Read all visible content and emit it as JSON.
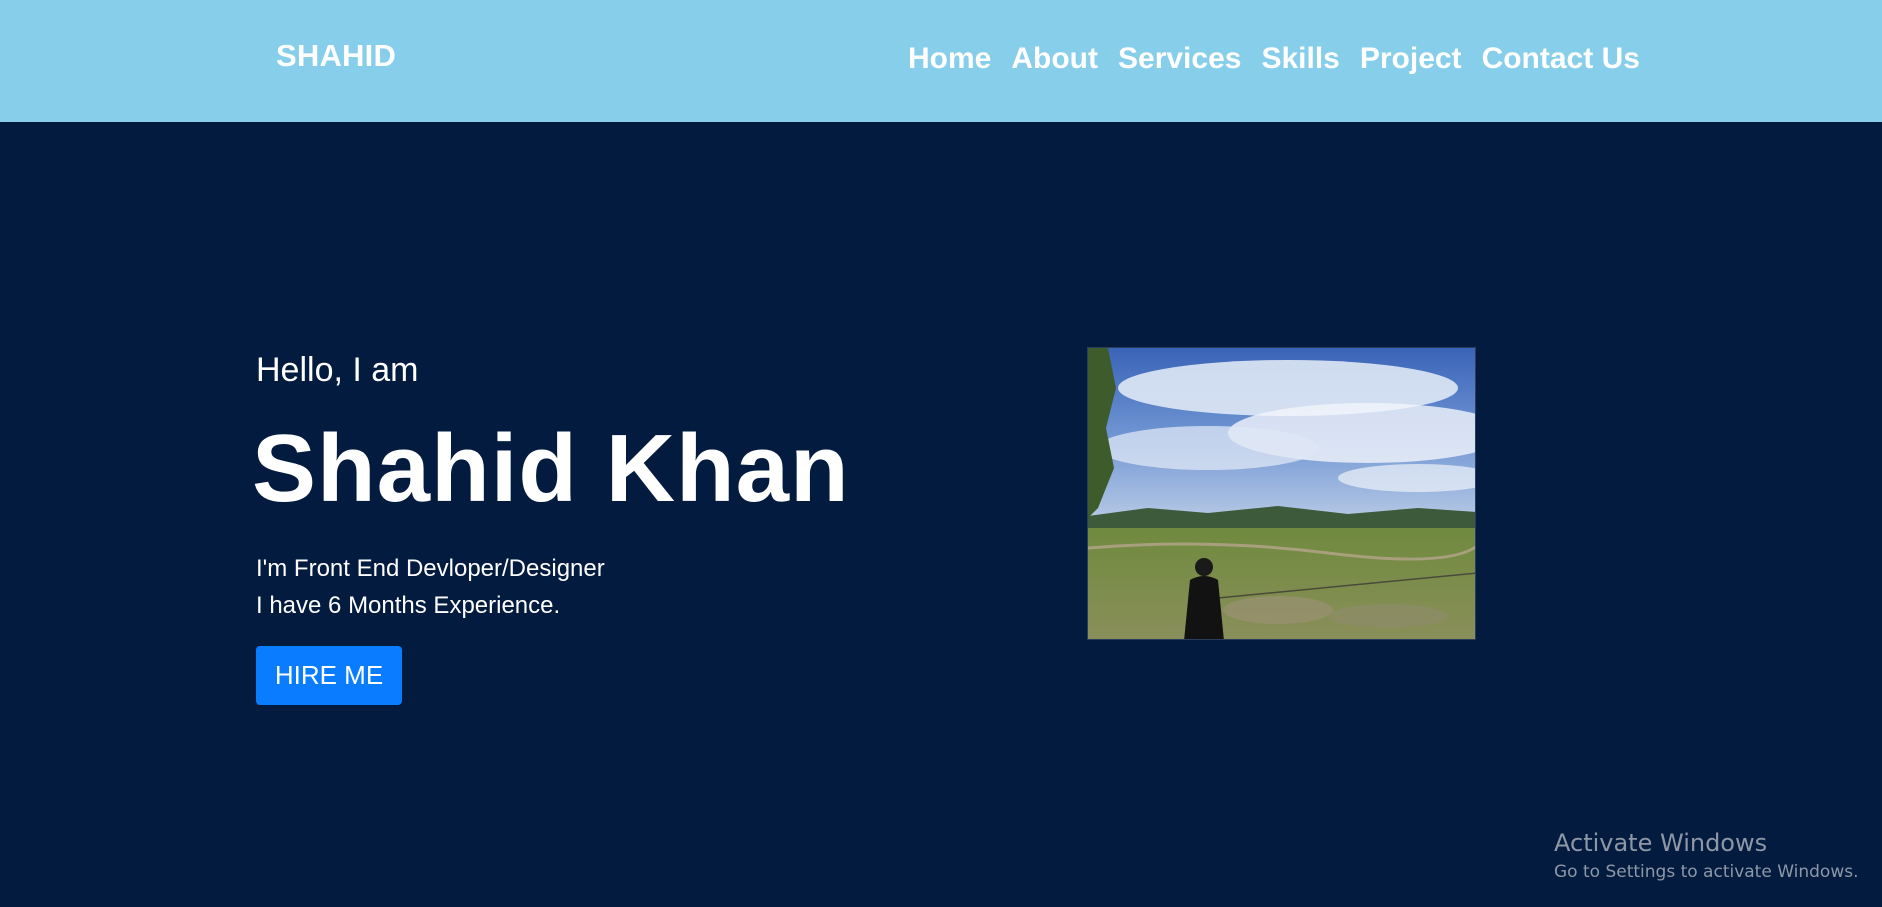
{
  "navbar": {
    "brand": "SHAHID",
    "links": [
      "Home",
      "About",
      "Services",
      "Skills",
      "Project",
      "Contact Us"
    ],
    "background_color": "#87ceeb"
  },
  "hero": {
    "greeting": "Hello, I am",
    "name": "Shahid Khan",
    "tagline_line1": "I'm Front End Devloper/Designer",
    "tagline_line2": "I have 6 Months Experience.",
    "hire_button": "HIRE ME",
    "background_color": "#021b3f",
    "button_color": "#0a7cff"
  },
  "system_overlay": {
    "title": "Activate Windows",
    "subtitle": "Go to Settings to activate Windows."
  }
}
